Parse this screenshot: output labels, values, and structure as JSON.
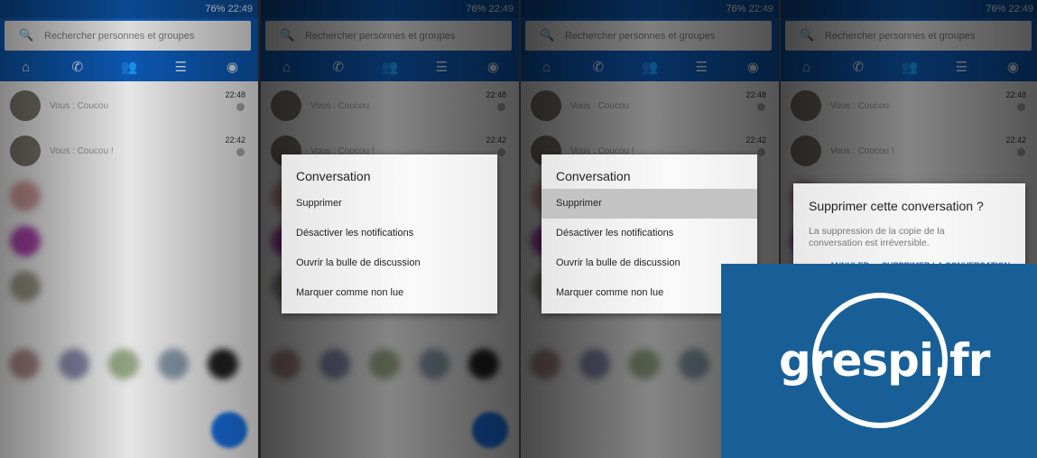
{
  "status": {
    "battery": "76%",
    "time": "22:49"
  },
  "search": {
    "placeholder": "Rechercher personnes et groupes"
  },
  "tabs": [
    {
      "icon": "home-icon",
      "glyph": "⌂"
    },
    {
      "icon": "phone-icon",
      "glyph": "✆"
    },
    {
      "icon": "people-icon",
      "glyph": "👥"
    },
    {
      "icon": "list-icon",
      "glyph": "☰"
    },
    {
      "icon": "profile-icon",
      "glyph": "◉"
    }
  ],
  "conversations": [
    {
      "message": "Vous : Coucou",
      "time": "22:48"
    },
    {
      "message": "Vous : Coucou !",
      "time": "22:42"
    }
  ],
  "context_menu": {
    "title": "Conversation",
    "items": [
      "Supprimer",
      "Désactiver les notifications",
      "Ouvrir la bulle de discussion",
      "Marquer comme non lue"
    ]
  },
  "confirm_dialog": {
    "title": "Supprimer cette conversation ?",
    "description": "La suppression de la copie de la conversation est irréversible.",
    "cancel": "ANNULER",
    "confirm": "SUPPRIMER LA CONVERSATION"
  },
  "logo": {
    "text": "grespi.fr",
    "color": "#195f97"
  },
  "colors": {
    "accent": "#0d5bb8",
    "fab": "#1a73e8"
  }
}
